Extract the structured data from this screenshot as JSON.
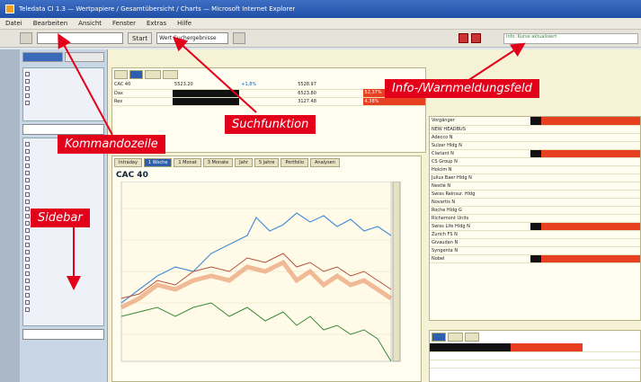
{
  "window": {
    "title": "Teledata CI 1.3 — Wertpapiere / Gesamtübersicht / Charts — Microsoft Internet Explorer"
  },
  "menu": {
    "items": [
      "Datei",
      "Bearbeiten",
      "Ansicht",
      "Fenster",
      "Extras",
      "Hilfe"
    ]
  },
  "toolbar": {
    "start_label": "Start",
    "search_value": "Wert Suchergebnisse",
    "message_text": "Info: Kurse aktualisiert"
  },
  "watchlist": {
    "rows": [
      {
        "name": "CAC 40",
        "v1": "5523.20",
        "v2": "+1,8%",
        "v3": "5528.97"
      },
      {
        "name": "Dax",
        "v1": "",
        "v2": "",
        "v3": "6523.80"
      },
      {
        "name": "Rex",
        "v1": "",
        "v2": "",
        "v3": "3127.48"
      }
    ],
    "badges": [
      "52,37%",
      "4,38%"
    ]
  },
  "chart": {
    "title": "CAC 40",
    "tabs": [
      "Intraday",
      "1 Woche",
      "1 Monat",
      "3 Monate",
      "Jahr",
      "5 Jahre",
      "Portfolio",
      "Analysen"
    ]
  },
  "list": {
    "rows": [
      "Vorgänger",
      "NEW HEADBUS",
      "Adecco N",
      "Sulzer Hldg N",
      "Clariant N",
      "CS Group N",
      "Holcim N",
      "Julius Baer Hldg N",
      "Nestlé N",
      "Swiss Reinsur. Hldg",
      "Novartis N",
      "Roche Hldg G",
      "Richemont Units",
      "Swiss Life Hldg N",
      "Zurich FS N",
      "Givaudan N",
      "Syngenta N",
      "Nobel"
    ]
  },
  "annotations": {
    "command_line": "Kommandozeile",
    "search": "Suchfunktion",
    "message_field": "Info-/Warnmeldungsfeld",
    "sidebar": "Sidebar"
  },
  "colors": {
    "accent": "#e2001a",
    "brand": "#2e5fae"
  }
}
